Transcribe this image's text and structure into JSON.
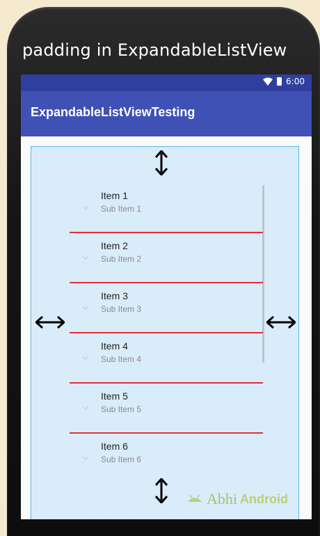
{
  "banner": {
    "text": "padding in ExpandableListView"
  },
  "statusbar": {
    "time": "6:00"
  },
  "appbar": {
    "title": "ExpandableListViewTesting"
  },
  "list": {
    "items": [
      {
        "title": "Item 1",
        "sub": "Sub Item 1"
      },
      {
        "title": "Item 2",
        "sub": "Sub Item 2"
      },
      {
        "title": "Item 3",
        "sub": "Sub Item 3"
      },
      {
        "title": "Item 4",
        "sub": "Sub Item 4"
      },
      {
        "title": "Item 5",
        "sub": "Sub Item 5"
      },
      {
        "title": "Item 6",
        "sub": "Sub Item 6"
      }
    ]
  },
  "watermark": {
    "part1": "Abhi",
    "part2": "Android"
  },
  "colors": {
    "statusbar": "#303f9f",
    "appbar": "#3f51b5",
    "divider": "#e0303a",
    "frame_border": "#5ab4ee",
    "frame_fill": "#d9ecfa"
  }
}
